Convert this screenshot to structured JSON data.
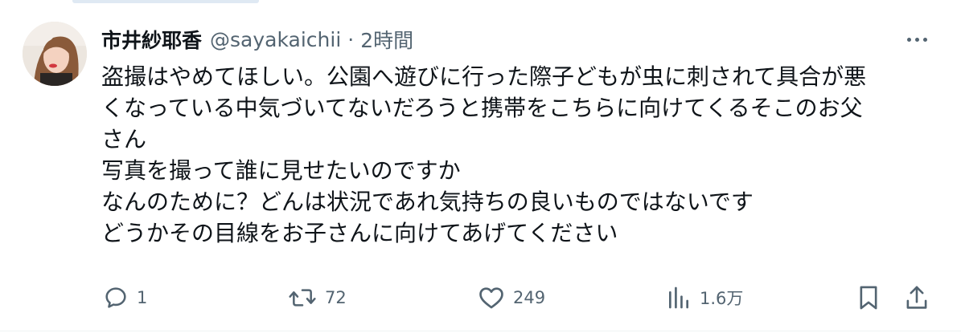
{
  "author": {
    "display_name": "市井紗耶香",
    "handle": "@sayakaichii",
    "separator": "·",
    "time": "2時間"
  },
  "tweet": {
    "lines": [
      "盗撮はやめてほしい。公園へ遊びに行った際子どもが虫に刺されて具合が悪",
      "くなっている中気づいてないだろうと携帯をこちらに向けてくるそこのお父",
      "さん",
      "写真を撮って誰に見せたいのですか",
      "なんのために？どんは状況であれ気持ちの良いものではないです",
      "どうかその目線をお子さんに向けてあげてください"
    ]
  },
  "actions": {
    "reply_count": "1",
    "retweet_count": "72",
    "like_count": "249",
    "view_count": "1.6万"
  },
  "icons": {
    "more": "more-icon",
    "reply": "reply-icon",
    "retweet": "retweet-icon",
    "like": "heart-icon",
    "views": "views-icon",
    "bookmark": "bookmark-icon",
    "share": "share-icon"
  },
  "colors": {
    "text": "#0f1419",
    "secondary": "#536471",
    "divider": "#eff3f4"
  }
}
